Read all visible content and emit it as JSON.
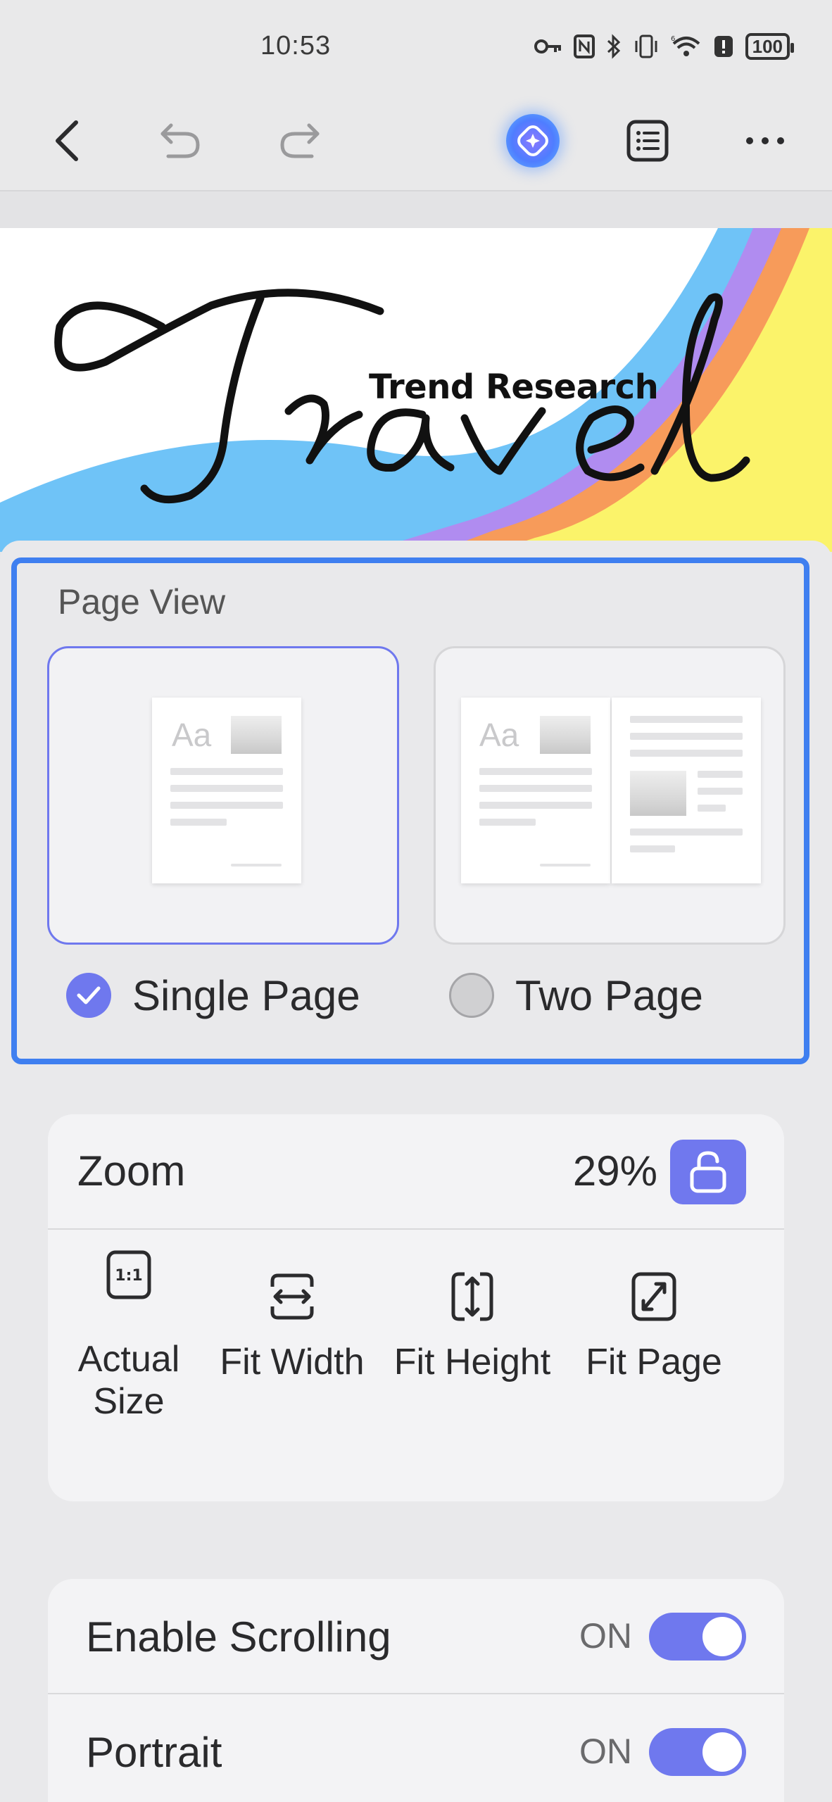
{
  "status_bar": {
    "time": "10:53",
    "battery": "100",
    "icons": [
      "key-icon",
      "nfc-icon",
      "bluetooth-icon",
      "vibrate-icon",
      "wifi-6-icon",
      "alert-icon",
      "battery-icon"
    ]
  },
  "toolbar": {
    "icons": [
      "back-icon",
      "undo-icon",
      "redo-icon",
      "ai-assistant-icon",
      "outline-icon",
      "more-icon"
    ]
  },
  "document": {
    "title_script": "Travel",
    "subtitle": "Trend Research"
  },
  "page_view": {
    "title": "Page View",
    "options": [
      {
        "label": "Single Page",
        "selected": true
      },
      {
        "label": "Two Page",
        "selected": false
      }
    ],
    "thumbnail_text": "Aa"
  },
  "zoom": {
    "label": "Zoom",
    "value": "29%",
    "lock_icon": "unlock-icon",
    "options": [
      {
        "label": "Actual Size",
        "icon": "actual-size-icon",
        "icon_text": "1:1"
      },
      {
        "label": "Fit Width",
        "icon": "fit-width-icon"
      },
      {
        "label": "Fit Height",
        "icon": "fit-height-icon"
      },
      {
        "label": "Fit Page",
        "icon": "fit-page-icon"
      }
    ]
  },
  "settings": [
    {
      "label": "Enable Scrolling",
      "state": "ON",
      "on": true
    },
    {
      "label": "Portrait",
      "state": "ON",
      "on": true
    }
  ],
  "colors": {
    "accent": "#6f78ee",
    "selection_border": "#3f7ff0"
  }
}
